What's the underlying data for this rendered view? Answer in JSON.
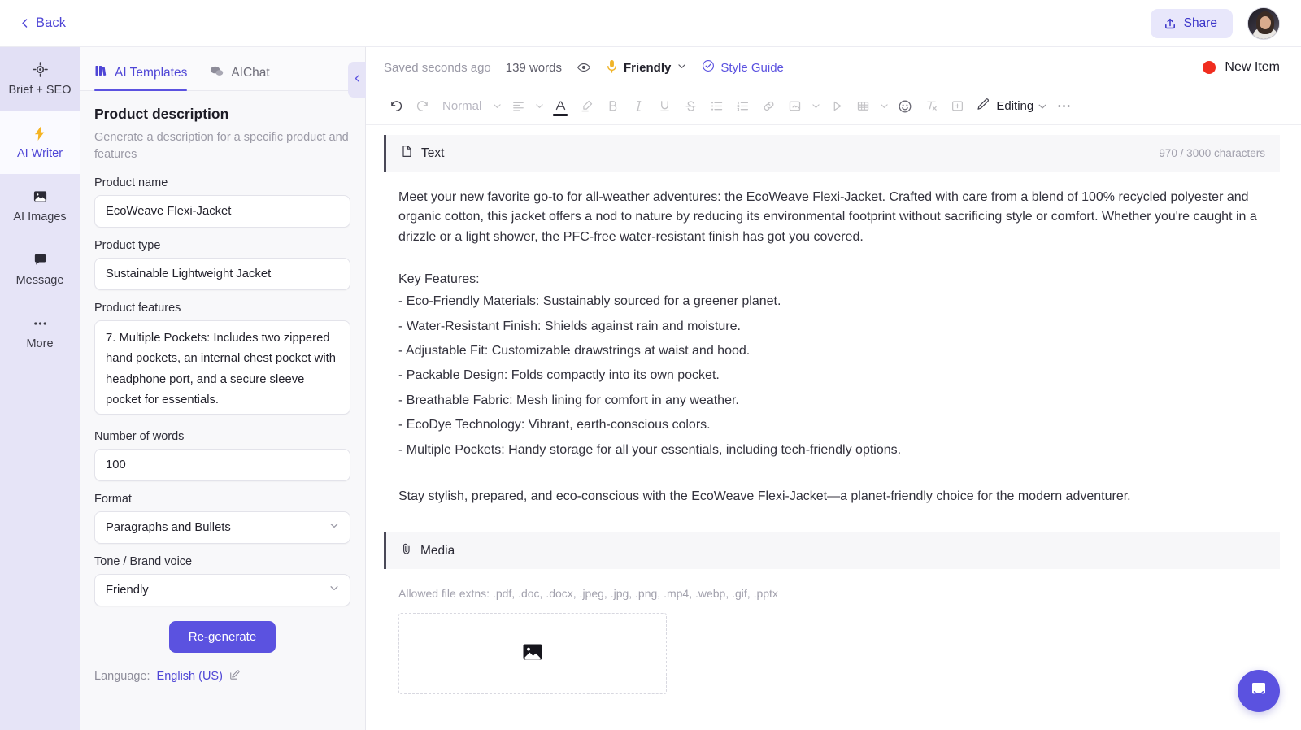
{
  "topbar": {
    "back_label": "Back",
    "share_label": "Share",
    "back_icon": "chevron-left-icon",
    "share_icon": "upload-icon",
    "avatar_icon": "user-avatar"
  },
  "rail": {
    "items": [
      {
        "label": "Brief + SEO",
        "icon": "target-icon",
        "state": "hover"
      },
      {
        "label": "AI Writer",
        "icon": "lightning-bolt-icon",
        "state": "active"
      },
      {
        "label": "AI Images",
        "icon": "image-icon",
        "state": "default"
      },
      {
        "label": "Message",
        "icon": "chat-icon",
        "state": "default"
      },
      {
        "label": "More",
        "icon": "ellipsis-icon",
        "state": "default"
      }
    ]
  },
  "panel": {
    "tabs": [
      {
        "label": "AI Templates",
        "icon": "templates-grid-icon",
        "active": true
      },
      {
        "label": "AIChat",
        "icon": "chat-bubbles-icon",
        "active": false
      }
    ],
    "collapse_icon": "chevron-left-icon",
    "template_title": "Product description",
    "template_desc": "Generate a description for a specific product and features",
    "fields": {
      "product_name": {
        "label": "Product name",
        "value": "EcoWeave Flexi-Jacket"
      },
      "product_type": {
        "label": "Product type",
        "value": "Sustainable Lightweight Jacket"
      },
      "product_features": {
        "label": "Product features",
        "value": "7. Multiple Pockets: Includes two zippered hand pockets, an internal chest pocket with headphone port, and a secure sleeve pocket for essentials."
      },
      "number_of_words": {
        "label": "Number of words",
        "value": "100"
      },
      "format": {
        "label": "Format",
        "value": "Paragraphs and Bullets"
      },
      "tone": {
        "label": "Tone / Brand voice",
        "value": "Friendly"
      }
    },
    "regenerate_label": "Re-generate",
    "language_prefix": "Language:",
    "language_value": "English (US)",
    "language_edit_icon": "pencil-square-icon"
  },
  "editor": {
    "meta": {
      "saved_status": "Saved seconds ago",
      "word_count": "139 words",
      "preview_icon": "eye-icon",
      "tone_icon": "microphone-icon",
      "tone_value": "Friendly",
      "tone_caret_icon": "chevron-down-icon",
      "style_guide_icon": "check-circle-icon",
      "style_guide_label": "Style Guide",
      "new_item_label": "New Item"
    },
    "toolbar": {
      "undo_icon": "undo-icon",
      "redo_icon": "redo-icon",
      "paragraph_style": "Normal",
      "style_caret_icon": "chevron-down-icon",
      "align_icon": "align-left-icon",
      "align_caret_icon": "chevron-down-icon",
      "font_color_icon": "font-color-icon",
      "highlight_icon": "highlighter-icon",
      "bold_icon": "bold-icon",
      "italic_icon": "italic-icon",
      "underline_icon": "underline-icon",
      "strikethrough_icon": "strikethrough-icon",
      "bullet_list_icon": "bullet-list-icon",
      "numbered_list_icon": "numbered-list-icon",
      "link_icon": "link-icon",
      "image_icon": "image-icon",
      "image_caret_icon": "chevron-down-icon",
      "video_icon": "video-play-icon",
      "table_icon": "table-icon",
      "table_caret_icon": "chevron-down-icon",
      "emoji_icon": "emoji-smiley-icon",
      "clear_format_icon": "clear-format-icon",
      "comment_icon": "add-comment-icon",
      "mode_icon": "pencil-icon",
      "mode_label": "Editing",
      "mode_caret_icon": "chevron-down-icon",
      "more_icon": "ellipsis-icon"
    },
    "text_section": {
      "icon": "document-icon",
      "title": "Text",
      "char_count": "970 / 3000 characters",
      "intro": "Meet your new favorite go-to for all-weather adventures: the EcoWeave Flexi-Jacket. Crafted with care from a blend of 100% recycled polyester and organic cotton, this jacket offers a nod to nature by reducing its environmental footprint without sacrificing style or comfort. Whether you're caught in a drizzle or a light shower, the PFC-free water-resistant finish has got you covered.",
      "features_heading": "Key Features:",
      "features": [
        "- Eco-Friendly Materials: Sustainably sourced for a greener planet.",
        "- Water-Resistant Finish: Shields against rain and moisture.",
        "- Adjustable Fit: Customizable drawstrings at waist and hood.",
        "- Packable Design: Folds compactly into its own pocket.",
        "- Breathable Fabric: Mesh lining for comfort in any weather.",
        "- EcoDye Technology: Vibrant, earth-conscious colors.",
        "- Multiple Pockets: Handy storage for all your essentials, including tech-friendly options."
      ],
      "closing": "Stay stylish, prepared, and eco-conscious with the EcoWeave Flexi-Jacket—a planet-friendly choice for the modern adventurer."
    },
    "media_section": {
      "icon": "paperclip-icon",
      "title": "Media",
      "allowed": "Allowed file extns: .pdf, .doc, .docx, .jpeg, .jpg, .png, .mp4, .webp, .gif, .pptx",
      "dropzone_icon": "image-placeholder-icon"
    }
  },
  "support": {
    "chat_icon": "intercom-chat-icon"
  },
  "colors": {
    "accent": "#5b52e0",
    "accent_link": "#4f46d6",
    "rail_bg": "#e6e4f7",
    "share_bg": "#e8e7fb",
    "new_item_dot": "#f02d1f",
    "panel_bg": "#f8f8fa"
  }
}
